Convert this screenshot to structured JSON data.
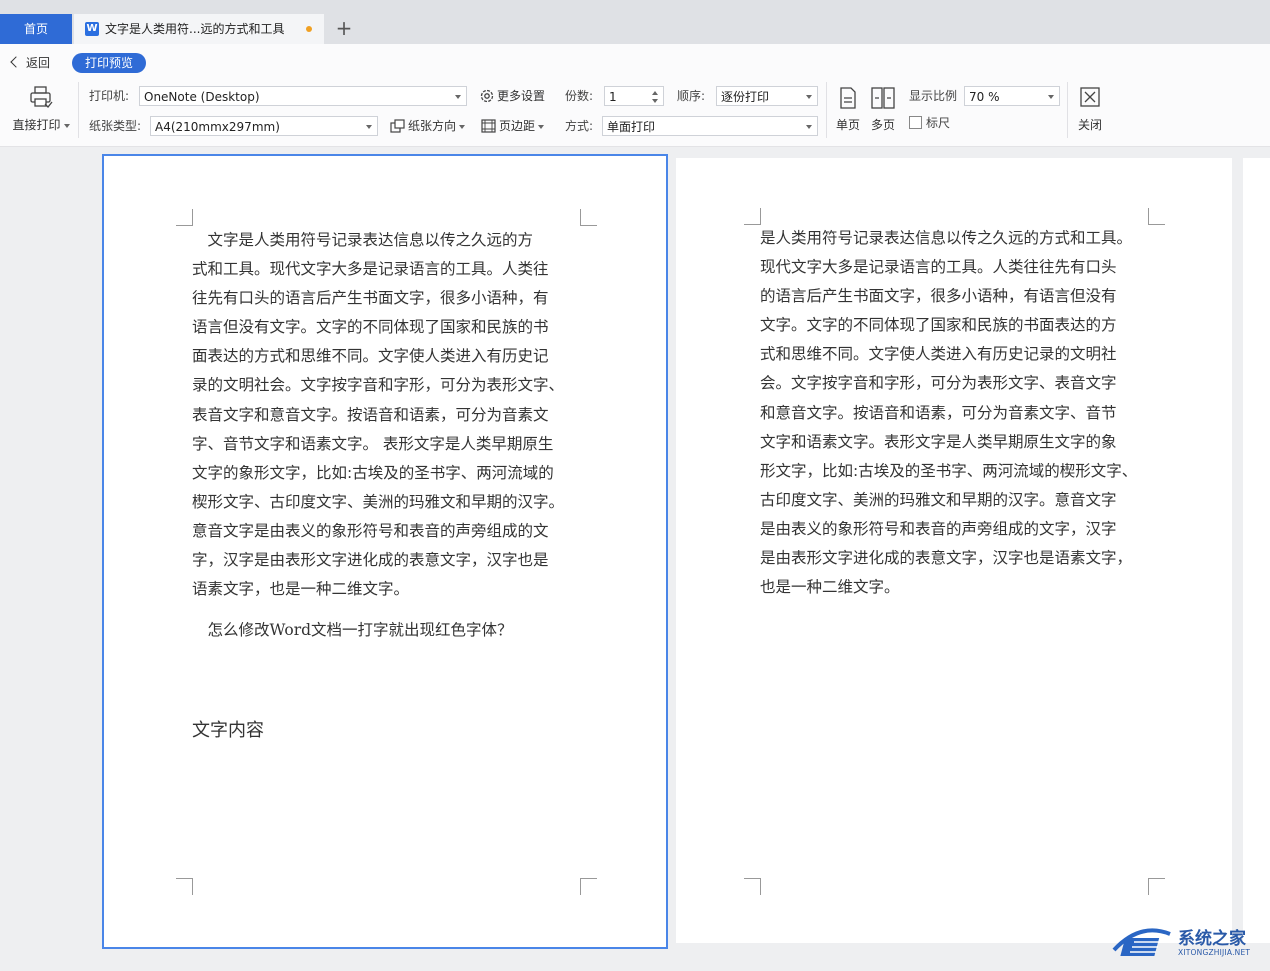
{
  "tabs": {
    "home_label": "首页",
    "doc_title": "文字是人类用符...远的方式和工具",
    "add_symbol": "+",
    "doc_icon_letter": "W"
  },
  "toolbar": {
    "back_label": "返回",
    "print_preview_label": "打印预览",
    "direct_print_label": "直接打印",
    "printer_label": "打印机:",
    "printer_value": "OneNote (Desktop)",
    "more_settings_label": "更多设置",
    "copies_label": "份数:",
    "copies_value": "1",
    "order_label": "顺序:",
    "order_value": "逐份打印",
    "paper_type_label": "纸张类型:",
    "paper_type_value": "A4(210mmx297mm)",
    "orientation_label": "纸张方向",
    "margins_label": "页边距",
    "mode_label": "方式:",
    "mode_value": "单面打印",
    "single_page_label": "单页",
    "multi_page_label": "多页",
    "zoom_label": "显示比例",
    "zoom_value": "70 %",
    "ruler_label": "标尺",
    "close_label": "关闭"
  },
  "page1": {
    "lines": [
      "　文字是人类用符号记录表达信息以传之久远的方",
      "式和工具。现代文字大多是记录语言的工具。人类往",
      "往先有口头的语言后产生书面文字，很多小语种，有",
      "语言但没有文字。文字的不同体现了国家和民族的书",
      "面表达的方式和思维不同。文字使人类进入有历史记",
      "录的文明社会。文字按字音和字形，可分为表形文字、",
      "表音文字和意音文字。按语音和语素，可分为音素文",
      "字、音节文字和语素文字。 表形文字是人类早期原生",
      "文字的象形文字，比如:古埃及的圣书字、两河流域的",
      "楔形文字、古印度文字、美洲的玛雅文和早期的汉字。",
      "意音文字是由表义的象形符号和表音的声旁组成的文",
      "字，汉字是由表形文字进化成的表意文字，汉字也是",
      "语素文字，也是一种二维文字。"
    ],
    "question": "　怎么修改Word文档一打字就出现红色字体？",
    "heading": "文字内容"
  },
  "page2": {
    "lines": [
      "是人类用符号记录表达信息以传之久远的方式和工具。",
      "现代文字大多是记录语言的工具。人类往往先有口头",
      "的语言后产生书面文字，很多小语种，有语言但没有",
      "文字。文字的不同体现了国家和民族的书面表达的方",
      "式和思维不同。文字使人类进入有历史记录的文明社",
      "会。文字按字音和字形，可分为表形文字、表音文字",
      "和意音文字。按语音和语素，可分为音素文字、音节",
      "文字和语素文字。表形文字是人类早期原生文字的象",
      "形文字，比如:古埃及的圣书字、两河流域的楔形文字、",
      "古印度文字、美洲的玛雅文和早期的汉字。意音文字",
      "是由表义的象形符号和表音的声旁组成的文字，汉字",
      "是由表形文字进化成的表意文字，汉字也是语素文字，",
      "也是一种二维文字。"
    ]
  },
  "watermark": {
    "name": "系统之家",
    "url": "XITONGZHIJIA.NET"
  },
  "colors": {
    "accent": "#2f6bd6",
    "page_selected_border": "#4a86e8",
    "unsaved_dot": "#f0a023"
  }
}
